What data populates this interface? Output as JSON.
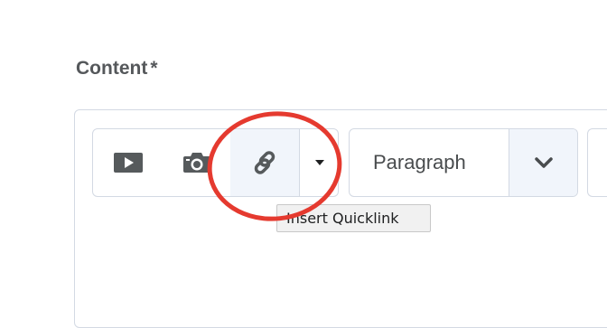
{
  "field": {
    "label": "Content",
    "required_marker": "*"
  },
  "toolbar": {
    "buttons": [
      {
        "icon": "video-icon"
      },
      {
        "icon": "camera-icon"
      },
      {
        "icon": "link-icon",
        "highlighted": true
      },
      {
        "icon": "caret-down-icon"
      }
    ],
    "format_select": {
      "value": "Paragraph",
      "icon": "chevron-down-icon"
    }
  },
  "tooltip": {
    "text": "Insert Quicklink"
  },
  "annotation": {
    "shape": "circle",
    "color": "#e53a2f"
  },
  "colors": {
    "icon": "#565a5c",
    "border": "#d3d9e3",
    "button_active_bg": "#f1f5fb"
  }
}
